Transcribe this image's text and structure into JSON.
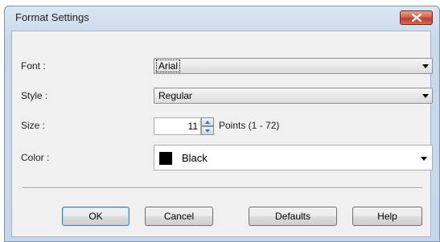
{
  "window": {
    "title": "Format Settings"
  },
  "form": {
    "font": {
      "label": "Font :",
      "value": "Arial"
    },
    "style": {
      "label": "Style :",
      "value": "Regular"
    },
    "size": {
      "label": "Size :",
      "value": "11",
      "hint": "Points (1 - 72)"
    },
    "color": {
      "label": "Color :",
      "value": "Black",
      "swatch": "#000000"
    }
  },
  "buttons": {
    "ok": "OK",
    "cancel": "Cancel",
    "defaults": "Defaults",
    "help": "Help"
  },
  "icons": {
    "close": "close-icon",
    "dropdown": "chevron-down-icon",
    "spin_up": "spin-up-icon",
    "spin_down": "spin-down-icon"
  }
}
